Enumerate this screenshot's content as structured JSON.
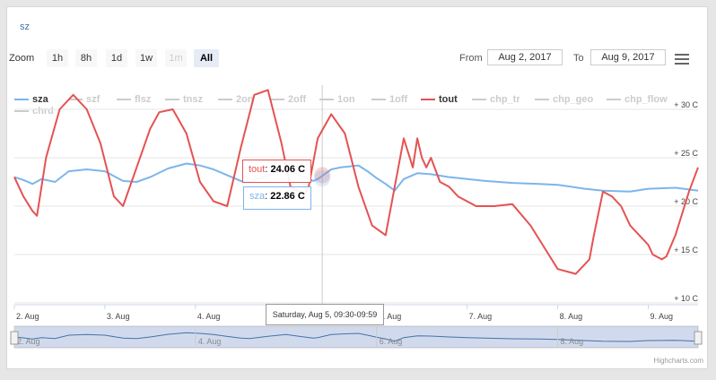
{
  "title": "sz",
  "toolbar": {
    "zoom_label": "Zoom",
    "buttons": [
      "1h",
      "8h",
      "1d",
      "1w",
      "1m",
      "All"
    ],
    "from_label": "From",
    "from_value": "Aug 2, 2017",
    "to_label": "To",
    "to_value": "Aug 9, 2017"
  },
  "credit": "Highcharts.com",
  "tooltip": {
    "tout_label": "tout",
    "tout_value": "24.06 C",
    "sza_label": "sza",
    "sza_value": "22.86 C",
    "x_label": "Saturday, Aug 5, 09:30-09:59"
  },
  "colors": {
    "sza": "#7cb5ec",
    "tout": "#e55252",
    "inactive": "#cccccc",
    "navigator_fill": "#ccd6eb",
    "navigator_line": "#4572a7"
  },
  "chart_data": {
    "type": "line",
    "ylim": [
      10,
      30
    ],
    "yticks": [
      "+ 10 C",
      "+ 15 C",
      "+ 20 C",
      "+ 25 C",
      "+ 30 C"
    ],
    "x_range_days": [
      2.0,
      9.55
    ],
    "xticks": [
      "2. Aug",
      "3. Aug",
      "4. Aug",
      "5. Aug",
      "6. Aug",
      "7. Aug",
      "8. Aug",
      "9. Aug"
    ],
    "navigator_ticks": [
      "2. Aug",
      "4. Aug",
      "6. Aug",
      "8. Aug"
    ],
    "legend": [
      "sza",
      "szf",
      "flsz",
      "tnsz",
      "2on",
      "2off",
      "1on",
      "1off",
      "tout",
      "chp_tr",
      "chp_geo",
      "chp_flow",
      "chrd"
    ],
    "active_series": [
      "sza",
      "tout"
    ],
    "series": [
      {
        "name": "sza",
        "x": [
          2.0,
          2.1,
          2.2,
          2.3,
          2.45,
          2.6,
          2.8,
          3.0,
          3.2,
          3.35,
          3.5,
          3.7,
          3.9,
          4.05,
          4.2,
          4.4,
          4.5,
          4.6,
          4.8,
          5.0,
          5.2,
          5.3,
          5.35,
          5.5,
          5.6,
          5.8,
          5.9,
          6.0,
          6.1,
          6.2,
          6.3,
          6.45,
          6.6,
          6.8,
          7.0,
          7.2,
          7.5,
          7.8,
          8.0,
          8.3,
          8.5,
          8.8,
          9.0,
          9.3,
          9.55
        ],
        "y": [
          23.0,
          22.7,
          22.3,
          22.8,
          22.5,
          23.6,
          23.8,
          23.6,
          22.6,
          22.5,
          23.0,
          23.9,
          24.4,
          24.2,
          23.8,
          23.0,
          22.6,
          22.5,
          23.2,
          23.8,
          23.0,
          22.6,
          22.8,
          23.8,
          24.0,
          24.2,
          23.6,
          22.9,
          22.3,
          21.6,
          22.8,
          23.4,
          23.3,
          23.0,
          22.8,
          22.6,
          22.4,
          22.3,
          22.2,
          21.8,
          21.6,
          21.5,
          21.8,
          21.9,
          21.6
        ]
      },
      {
        "name": "tout",
        "x": [
          2.0,
          2.1,
          2.2,
          2.25,
          2.35,
          2.5,
          2.65,
          2.8,
          2.95,
          3.1,
          3.2,
          3.35,
          3.5,
          3.6,
          3.75,
          3.9,
          4.05,
          4.2,
          4.35,
          4.5,
          4.65,
          4.8,
          4.95,
          5.05,
          5.2,
          5.25,
          5.35,
          5.5,
          5.65,
          5.8,
          5.95,
          6.1,
          6.2,
          6.3,
          6.4,
          6.45,
          6.5,
          6.55,
          6.6,
          6.7,
          6.8,
          6.9,
          7.1,
          7.3,
          7.5,
          7.7,
          7.9,
          8.0,
          8.2,
          8.35,
          8.4,
          8.5,
          8.6,
          8.7,
          8.8,
          9.0,
          9.05,
          9.15,
          9.2,
          9.3,
          9.45,
          9.55
        ],
        "y": [
          23.0,
          21.0,
          19.5,
          19.0,
          25.0,
          30.0,
          31.5,
          30.0,
          26.5,
          21.0,
          20.0,
          24.0,
          28.0,
          29.7,
          30.0,
          27.5,
          22.5,
          20.5,
          20.0,
          26.0,
          31.5,
          32.0,
          26.5,
          22.0,
          21.2,
          22.0,
          27.0,
          29.5,
          27.5,
          22.0,
          18.0,
          17.0,
          22.0,
          27.0,
          24.0,
          27.0,
          25.0,
          24.0,
          25.0,
          22.5,
          22.0,
          21.0,
          20.0,
          20.0,
          20.2,
          18.0,
          15.0,
          13.5,
          13.0,
          14.5,
          17.0,
          21.5,
          21.0,
          20.0,
          18.0,
          16.0,
          15.0,
          14.5,
          14.8,
          17.0,
          21.5,
          24.0
        ]
      }
    ]
  }
}
